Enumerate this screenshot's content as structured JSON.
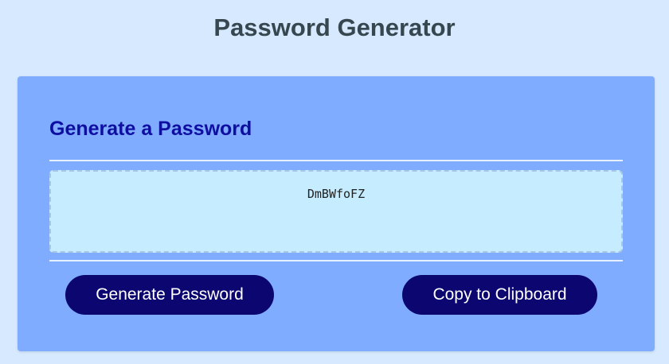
{
  "page": {
    "title": "Password Generator"
  },
  "card": {
    "header": "Generate a Password",
    "password_value": "DmBWfoFZ",
    "generate_label": "Generate Password",
    "copy_label": "Copy to Clipboard"
  },
  "colors": {
    "background": "#d6e9ff",
    "card": "#80acff",
    "header_text": "#0e0ea0",
    "password_box": "#c5edff",
    "button": "#0b0670"
  }
}
